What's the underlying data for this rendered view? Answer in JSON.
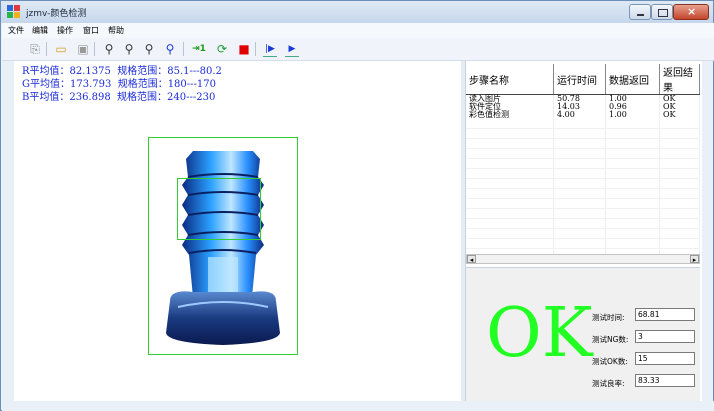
{
  "window": {
    "title": "jzmv-颜色检测"
  },
  "menu": [
    "文件",
    "编辑",
    "操作",
    "窗口",
    "帮助"
  ],
  "toolbar": {
    "buttons": [
      {
        "name": "new-icon",
        "glyph": "⎘"
      },
      {
        "name": "open-icon",
        "glyph": "📂"
      },
      {
        "name": "save-icon",
        "glyph": "💾"
      },
      {
        "name": "zoom-in-icon",
        "glyph": "🔍"
      },
      {
        "name": "zoom-out-icon",
        "glyph": "🔎"
      },
      {
        "name": "zoom-fit-icon",
        "glyph": "⌕"
      },
      {
        "name": "zoom-region-icon",
        "glyph": "⌕"
      },
      {
        "name": "step-icon",
        "glyph": "⇥1"
      },
      {
        "name": "refresh-icon",
        "glyph": "⟳"
      },
      {
        "name": "stop-icon",
        "glyph": "■"
      },
      {
        "name": "step-run-icon",
        "glyph": "⏵|"
      },
      {
        "name": "run-icon",
        "glyph": "▶"
      }
    ]
  },
  "results": {
    "r_line": "R平均值：82.1375  规格范围：85.1---80.2",
    "g_line": "G平均值：173.793  规格范围：180---170",
    "b_line": "B平均值：236.898  规格范围：240---230"
  },
  "table": {
    "headers": [
      "步骤名称",
      "运行时间",
      "数据返回",
      "返回结果"
    ],
    "rows": [
      [
        "读入图片",
        "50.78",
        "1.00",
        "OK"
      ],
      [
        "软件定位",
        "14.03",
        "0.96",
        "OK"
      ],
      [
        "彩色值检测",
        "4.00",
        "1.00",
        "OK"
      ]
    ]
  },
  "status": {
    "verdict": "OK",
    "verdict_color": "#22ff22",
    "test_time_label": "测试时间:",
    "test_time": "68.81",
    "ng_count_label": "测试NG数:",
    "ng_count": "3",
    "ok_count_label": "测试OK数:",
    "ok_count": "15",
    "yield_label": "测试良率:",
    "yield": "83.33"
  },
  "colors": {
    "accent": "#1a2bd8",
    "roi": "#33cc33",
    "stop": "#e00000"
  }
}
